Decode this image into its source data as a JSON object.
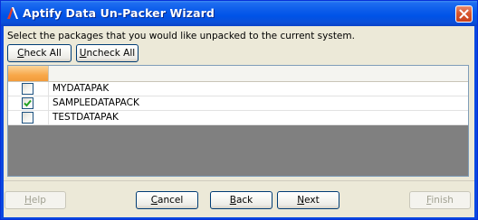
{
  "window": {
    "title": "Aptify Data Un-Packer Wizard"
  },
  "instruction": "Select the packages that you would like unpacked to the current system.",
  "toolbar": {
    "check_all": {
      "accel": "C",
      "rest": "heck All"
    },
    "uncheck_all": {
      "accel": "U",
      "rest": "ncheck All"
    }
  },
  "packages": [
    {
      "name": "MYDATAPAK",
      "checked": false
    },
    {
      "name": "SAMPLEDATAPACK",
      "checked": true
    },
    {
      "name": "TESTDATAPAK",
      "checked": false
    }
  ],
  "footer": {
    "help": {
      "accel": "H",
      "rest": "elp",
      "enabled": false
    },
    "cancel": {
      "accel": "C",
      "rest": "ancel",
      "enabled": true
    },
    "back": {
      "accel": "B",
      "rest": "ack",
      "enabled": true
    },
    "next": {
      "accel": "N",
      "rest": "ext",
      "enabled": true
    },
    "finish": {
      "accel": "F",
      "rest": "inish",
      "enabled": false
    }
  },
  "colors": {
    "titlebar": "#0053e8",
    "face": "#ece9d8",
    "grid_empty": "#808080",
    "header_corner": "#f8a94a",
    "check": "#21a121"
  },
  "icons": {
    "app": "aptify-logo-icon",
    "close": "close-icon",
    "check": "checkmark-icon"
  }
}
